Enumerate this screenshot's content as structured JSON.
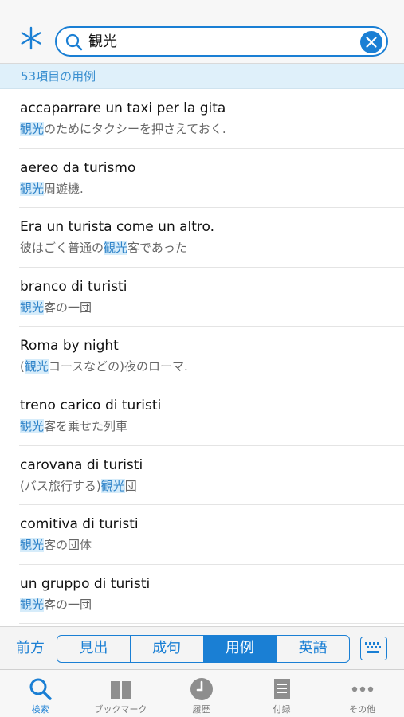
{
  "search": {
    "query": "観光",
    "result_count_label": "53項目の用例"
  },
  "results": [
    {
      "it": "accaparrare un taxi per la gita",
      "ja_pre": "",
      "ja_hl": "観光",
      "ja_post": "のためにタクシーを押さえておく."
    },
    {
      "it": "aereo da turismo",
      "ja_pre": "",
      "ja_hl": "観光",
      "ja_post": "周遊機."
    },
    {
      "it": "Era un turista come un altro.",
      "ja_pre": "彼はごく普通の",
      "ja_hl": "観光",
      "ja_post": "客であった"
    },
    {
      "it": "branco di turisti",
      "ja_pre": "",
      "ja_hl": "観光",
      "ja_post": "客の一団"
    },
    {
      "it": "Roma by night",
      "ja_pre": "(",
      "ja_hl": "観光",
      "ja_post": "コースなどの)夜のローマ."
    },
    {
      "it": "treno carico di turisti",
      "ja_pre": "",
      "ja_hl": "観光",
      "ja_post": "客を乗せた列車"
    },
    {
      "it": "carovana di turisti",
      "ja_pre": "(バス旅行する)",
      "ja_hl": "観光",
      "ja_post": "団"
    },
    {
      "it": "comitiva di turisti",
      "ja_pre": "",
      "ja_hl": "観光",
      "ja_post": "客の団体"
    },
    {
      "it": "un gruppo di turisti",
      "ja_pre": "",
      "ja_hl": "観光",
      "ja_post": "客の一団"
    }
  ],
  "segment_bar": {
    "prev_label": "前方",
    "segments": [
      "見出",
      "成句",
      "用例",
      "英語"
    ],
    "active_segment": "用例"
  },
  "tab_bar": {
    "items": [
      {
        "label": "検索",
        "icon": "search-icon",
        "active": true
      },
      {
        "label": "ブックマーク",
        "icon": "book-icon",
        "active": false
      },
      {
        "label": "履歴",
        "icon": "clock-icon",
        "active": false
      },
      {
        "label": "付録",
        "icon": "document-icon",
        "active": false
      },
      {
        "label": "その他",
        "icon": "more-icon",
        "active": false
      }
    ]
  },
  "colors": {
    "accent": "#1a7fd4",
    "highlight_bg": "#d6ecfa",
    "count_bar_bg": "#dff0fa"
  }
}
